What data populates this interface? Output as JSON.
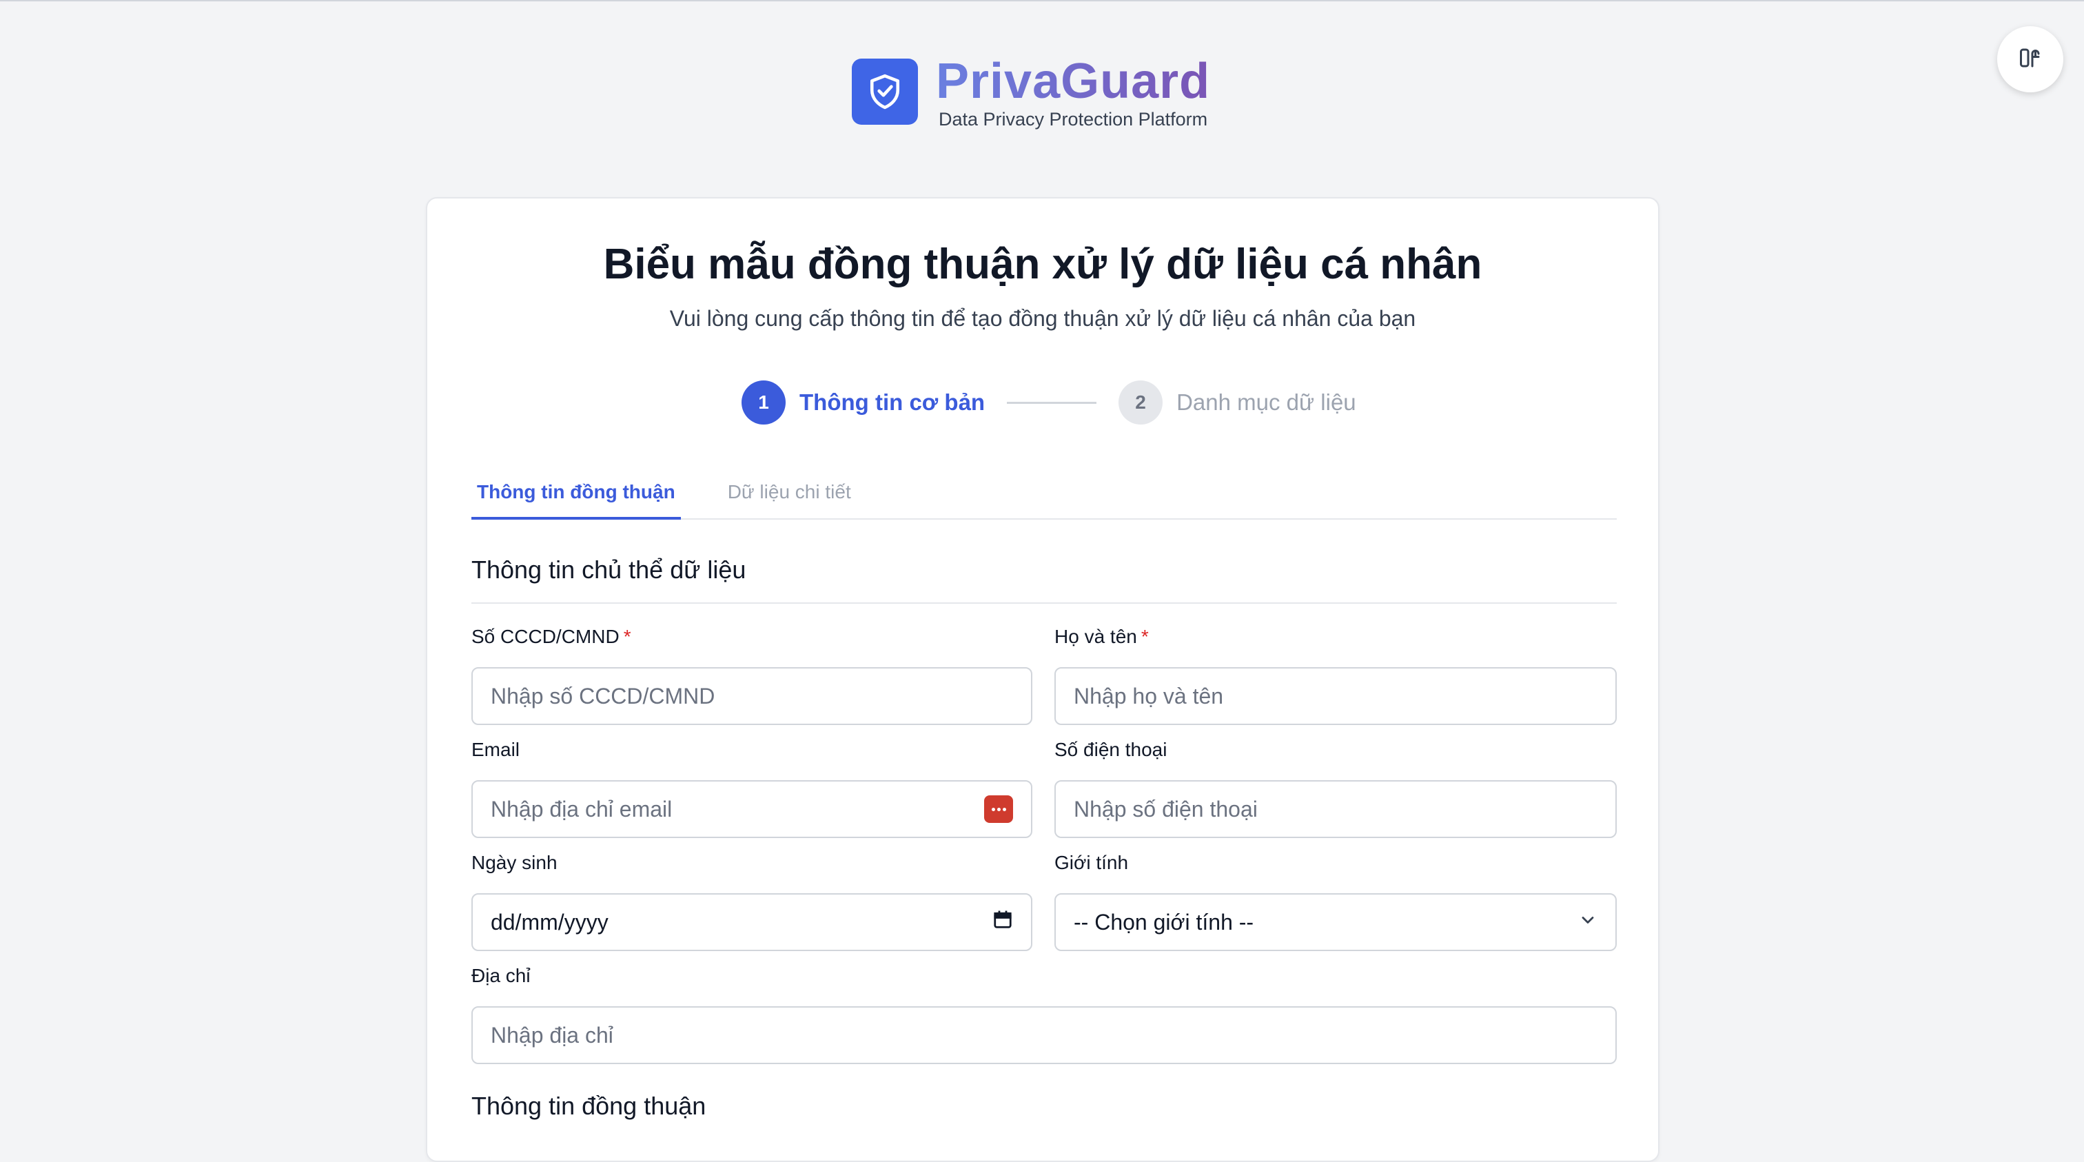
{
  "brand": {
    "name": "PrivaGuard",
    "tagline": "Data Privacy Protection Platform",
    "logo_icon": "shield-check-icon",
    "accent": "#3f65e6"
  },
  "corner_button": {
    "icon": "sidebar-toggle-icon"
  },
  "form": {
    "title": "Biểu mẫu đồng thuận xử lý dữ liệu cá nhân",
    "subtitle": "Vui lòng cung cấp thông tin để tạo đồng thuận xử lý dữ liệu cá nhân của bạn",
    "steps": [
      {
        "number": "1",
        "label": "Thông tin cơ bản",
        "state": "active"
      },
      {
        "number": "2",
        "label": "Danh mục dữ liệu",
        "state": "inactive"
      }
    ],
    "tabs": [
      {
        "label": "Thông tin đồng thuận",
        "state": "active"
      },
      {
        "label": "Dữ liệu chi tiết",
        "state": "inactive"
      }
    ],
    "section_subject": {
      "title": "Thông tin chủ thể dữ liệu",
      "fields": {
        "id_number": {
          "label": "Số CCCD/CMND",
          "required": "*",
          "placeholder": "Nhập số CCCD/CMND"
        },
        "full_name": {
          "label": "Họ và tên",
          "required": "*",
          "placeholder": "Nhập họ và tên"
        },
        "email": {
          "label": "Email",
          "placeholder": "Nhập địa chỉ email"
        },
        "phone": {
          "label": "Số điện thoại",
          "placeholder": "Nhập số điện thoại"
        },
        "dob": {
          "label": "Ngày sinh",
          "value": "dd/mm/yyyy"
        },
        "gender": {
          "label": "Giới tính",
          "selected": "-- Chọn giới tính --"
        },
        "address": {
          "label": "Địa chỉ",
          "placeholder": "Nhập địa chỉ"
        }
      }
    },
    "section_consent": {
      "title": "Thông tin đồng thuận"
    }
  }
}
